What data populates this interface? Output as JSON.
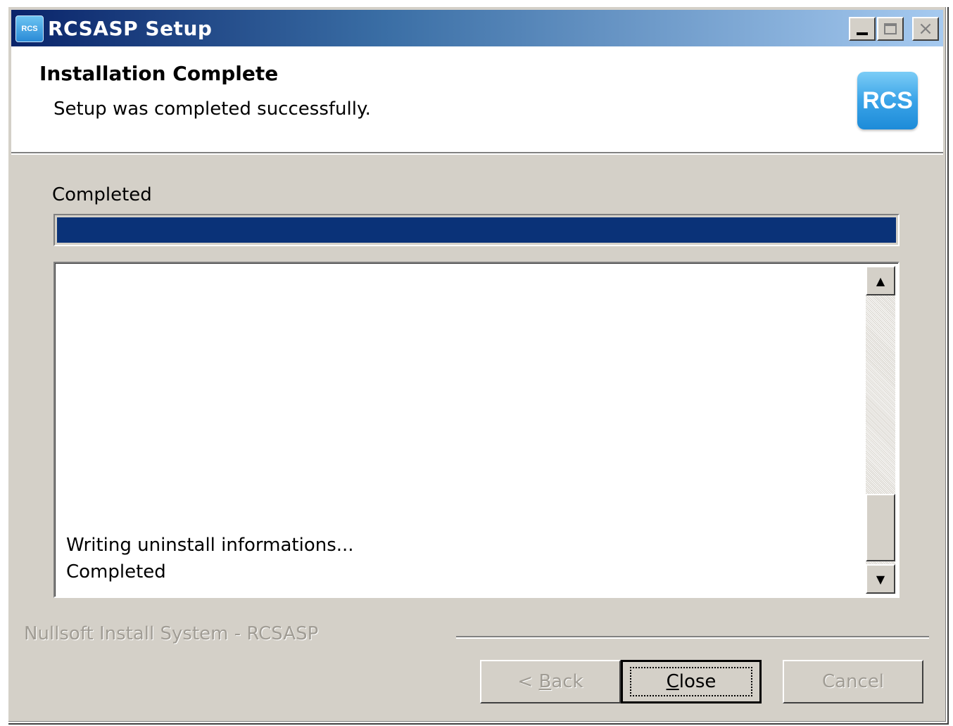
{
  "window": {
    "title": "RCSASP Setup",
    "app_icon_text": "RCS",
    "controls": {
      "minimize": "_",
      "maximize": "□",
      "close": "×"
    }
  },
  "header": {
    "title": "Installation Complete",
    "subtitle": "Setup was completed successfully.",
    "logo_text": "RCS"
  },
  "status": {
    "label": "Completed",
    "progress_percent": 100,
    "progress_color": "#0a3278"
  },
  "log": {
    "lines": [
      "Writing uninstall informations...",
      "Completed"
    ],
    "scroll_up": "▲",
    "scroll_down": "▼"
  },
  "footer": {
    "brand": "Nullsoft Install System - RCSASP",
    "back_prefix": "< ",
    "back_accel": "B",
    "back_rest": "ack",
    "close_accel": "C",
    "close_rest": "lose",
    "cancel_label": "Cancel"
  }
}
